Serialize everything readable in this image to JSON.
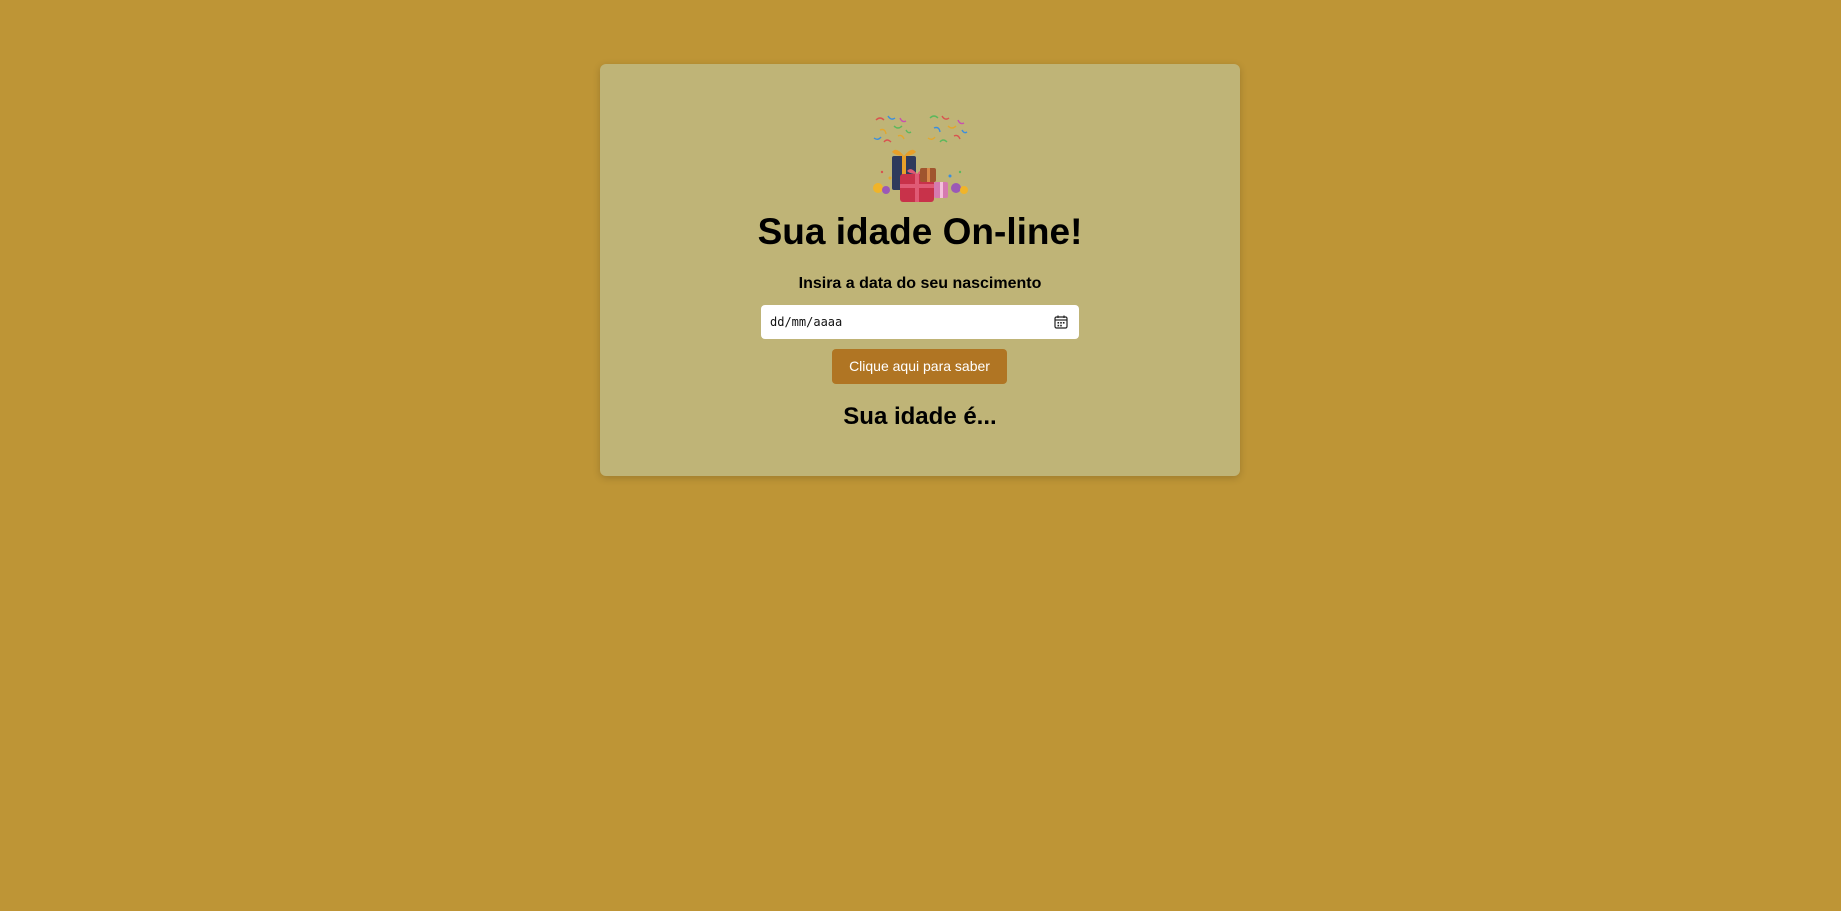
{
  "page": {
    "background_color": "#be9536",
    "card_color": "#bfb477",
    "accent_color": "#b07523"
  },
  "header": {
    "illustration": "birthday-gifts-confetti-icon",
    "title": "Sua idade On-line!"
  },
  "form": {
    "label": "Insira a data do seu nascimento",
    "date_placeholder": "dd/mm/aaaa",
    "calendar_icon": "calendar-icon",
    "submit_label": "Clique aqui para saber"
  },
  "result": {
    "text": "Sua idade é..."
  }
}
